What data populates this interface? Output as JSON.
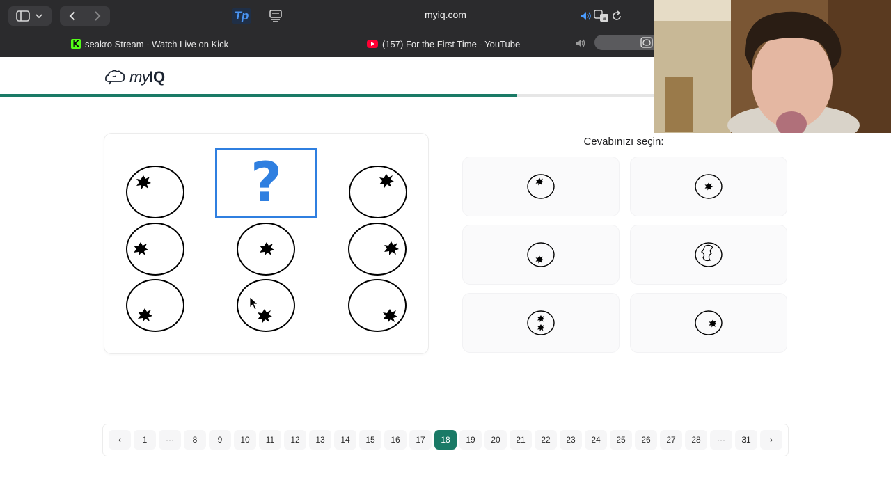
{
  "browser": {
    "url": "myiq.com",
    "tabs": [
      {
        "title": "seakro Stream - Watch Live on Kick",
        "icon": "kick-icon"
      },
      {
        "title": "(157) For the First Time - YouTube",
        "icon": "youtube-icon"
      }
    ],
    "extension_label": "Tp"
  },
  "site": {
    "logo_prefix": "my",
    "logo_suffix": "IQ",
    "progress": 0.58,
    "accent_color": "#1a7a66",
    "question_color": "#2f7fe0"
  },
  "puzzle": {
    "missing_label": "?"
  },
  "answers": {
    "title": "Cevabınızı seçin:"
  },
  "pagination": {
    "prev": "‹",
    "next": "›",
    "pages": [
      "1",
      "···",
      "8",
      "9",
      "10",
      "11",
      "12",
      "13",
      "14",
      "15",
      "16",
      "17",
      "18",
      "19",
      "20",
      "21",
      "22",
      "23",
      "24",
      "25",
      "26",
      "27",
      "28",
      "···",
      "31"
    ],
    "current": "18"
  }
}
